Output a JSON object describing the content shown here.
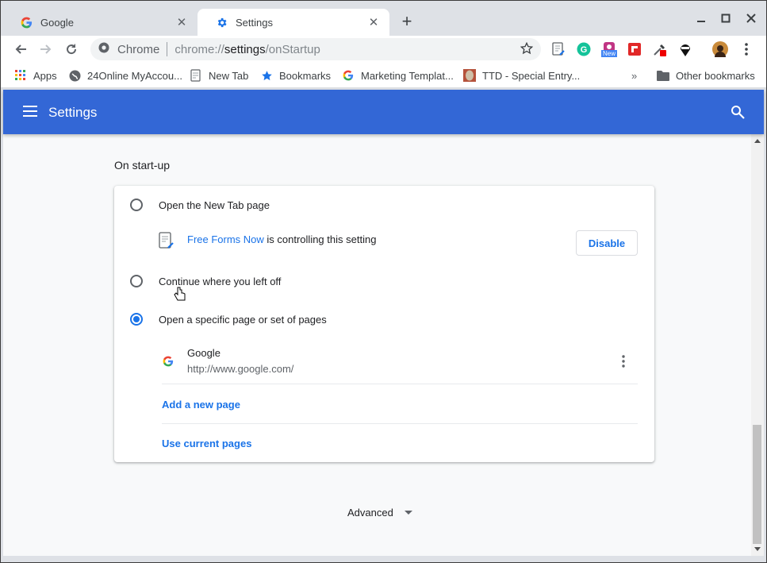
{
  "browser": {
    "tabs": [
      {
        "title": "Google",
        "icon": "google-g-icon",
        "active": false
      },
      {
        "title": "Settings",
        "icon": "gear-icon",
        "active": true
      }
    ],
    "new_tab_label": "+",
    "omnibox": {
      "security_label": "Chrome",
      "url_prefix": "chrome://",
      "url_host": "settings",
      "url_path": "/onStartup"
    },
    "extensions": [
      "free-forms-now-icon",
      "grammarly-icon",
      "instagram-new-icon",
      "flipboard-icon",
      "eyedropper-icon",
      "spy-icon"
    ],
    "extension_badge": "New",
    "bookmarks": [
      {
        "label": "Apps",
        "icon": "apps-grid-icon"
      },
      {
        "label": "24Online MyAccou...",
        "icon": "globe-icon"
      },
      {
        "label": "New Tab",
        "icon": "document-icon"
      },
      {
        "label": "Bookmarks",
        "icon": "star-icon"
      },
      {
        "label": "Marketing Templat...",
        "icon": "google-g-icon"
      },
      {
        "label": "TTD - Special Entry...",
        "icon": "ttd-icon"
      }
    ],
    "bookmarks_overflow": "»",
    "other_bookmarks": "Other bookmarks"
  },
  "settings": {
    "header_title": "Settings",
    "section_title": "On start-up",
    "options": [
      {
        "label": "Open the New Tab page",
        "selected": false
      },
      {
        "label": "Continue where you left off",
        "selected": false
      },
      {
        "label": "Open a specific page or set of pages",
        "selected": true
      }
    ],
    "controlled": {
      "extension_name": "Free Forms Now",
      "suffix": " is controlling this setting",
      "disable_label": "Disable"
    },
    "pages": [
      {
        "title": "Google",
        "url": "http://www.google.com/"
      }
    ],
    "add_page_label": "Add a new page",
    "use_current_label": "Use current pages",
    "advanced_label": "Advanced"
  },
  "colors": {
    "accent": "#1a73e8",
    "header": "#3367d6"
  }
}
